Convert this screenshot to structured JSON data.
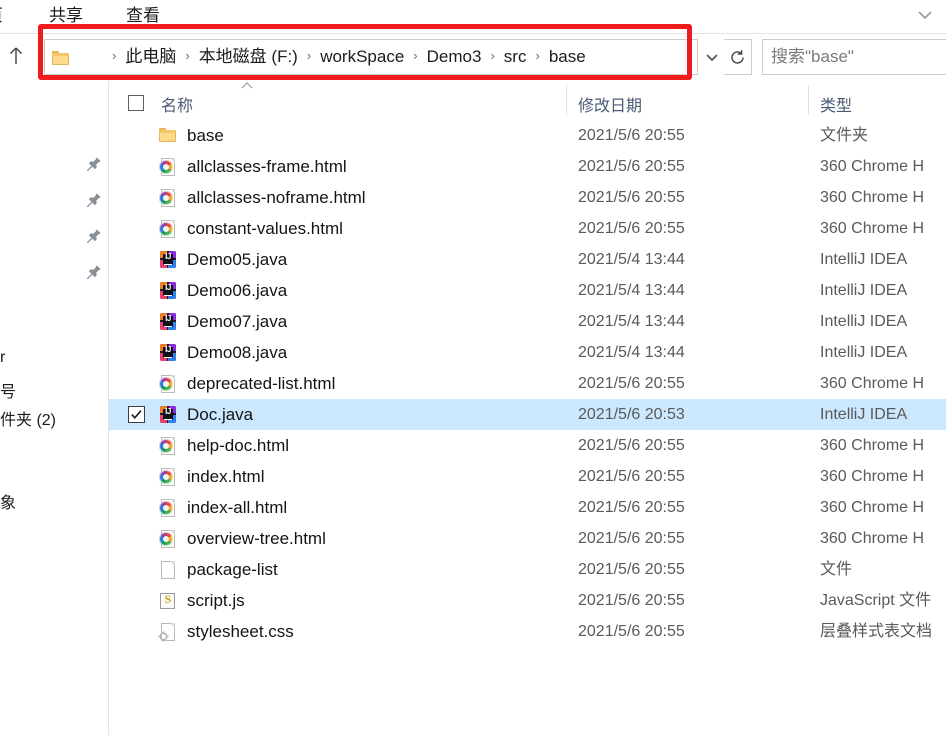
{
  "window": {
    "ribbon_tabs": [
      {
        "label": "页",
        "name": "tab-home"
      },
      {
        "label": "共享",
        "name": "tab-share"
      },
      {
        "label": "查看",
        "name": "tab-view"
      }
    ],
    "ribbon_expand_icon": "chevron-down-icon"
  },
  "navbar": {
    "up_icon": "arrow-up-icon",
    "folder_icon": "folder-icon",
    "breadcrumbs": [
      "此电脑",
      "本地磁盘 (F:)",
      "workSpace",
      "Demo3",
      "src",
      "base"
    ],
    "separator": "›",
    "dropdown_icon": "chevron-down-icon",
    "refresh_icon": "refresh-icon",
    "search": {
      "placeholder": "搜索\"base\"",
      "value": ""
    }
  },
  "annotation": {
    "shape": "rectangle",
    "color": "#ee1c1c"
  },
  "navpane": {
    "pins": [
      "pin-icon",
      "pin-icon",
      "pin-icon",
      "pin-icon"
    ],
    "labels": [
      "r",
      "号",
      "件夹 (2)",
      "象"
    ]
  },
  "columns": {
    "select_all_checkbox": "checkbox",
    "sort_indicator": "caret-up-icon",
    "headers": [
      "名称",
      "修改日期",
      "类型"
    ]
  },
  "files": [
    {
      "name": "base",
      "date": "2021/5/6 20:55",
      "type": "文件夹",
      "icon": "folder-icon",
      "selected": false
    },
    {
      "name": "allclasses-frame.html",
      "date": "2021/5/6 20:55",
      "type": "360 Chrome H",
      "icon": "chrome-html-icon",
      "selected": false
    },
    {
      "name": "allclasses-noframe.html",
      "date": "2021/5/6 20:55",
      "type": "360 Chrome H",
      "icon": "chrome-html-icon",
      "selected": false
    },
    {
      "name": "constant-values.html",
      "date": "2021/5/6 20:55",
      "type": "360 Chrome H",
      "icon": "chrome-html-icon",
      "selected": false
    },
    {
      "name": "Demo05.java",
      "date": "2021/5/4 13:44",
      "type": "IntelliJ IDEA",
      "icon": "intellij-idea-icon",
      "selected": false
    },
    {
      "name": "Demo06.java",
      "date": "2021/5/4 13:44",
      "type": "IntelliJ IDEA",
      "icon": "intellij-idea-icon",
      "selected": false
    },
    {
      "name": "Demo07.java",
      "date": "2021/5/4 13:44",
      "type": "IntelliJ IDEA",
      "icon": "intellij-idea-icon",
      "selected": false
    },
    {
      "name": "Demo08.java",
      "date": "2021/5/4 13:44",
      "type": "IntelliJ IDEA",
      "icon": "intellij-idea-icon",
      "selected": false
    },
    {
      "name": "deprecated-list.html",
      "date": "2021/5/6 20:55",
      "type": "360 Chrome H",
      "icon": "chrome-html-icon",
      "selected": false
    },
    {
      "name": "Doc.java",
      "date": "2021/5/6 20:53",
      "type": "IntelliJ IDEA",
      "icon": "intellij-idea-icon",
      "selected": true
    },
    {
      "name": "help-doc.html",
      "date": "2021/5/6 20:55",
      "type": "360 Chrome H",
      "icon": "chrome-html-icon",
      "selected": false
    },
    {
      "name": "index.html",
      "date": "2021/5/6 20:55",
      "type": "360 Chrome H",
      "icon": "chrome-html-icon",
      "selected": false
    },
    {
      "name": "index-all.html",
      "date": "2021/5/6 20:55",
      "type": "360 Chrome H",
      "icon": "chrome-html-icon",
      "selected": false
    },
    {
      "name": "overview-tree.html",
      "date": "2021/5/6 20:55",
      "type": "360 Chrome H",
      "icon": "chrome-html-icon",
      "selected": false
    },
    {
      "name": "package-list",
      "date": "2021/5/6 20:55",
      "type": "文件",
      "icon": "file-icon",
      "selected": false
    },
    {
      "name": "script.js",
      "date": "2021/5/6 20:55",
      "type": "JavaScript 文件",
      "icon": "javascript-icon",
      "selected": false
    },
    {
      "name": "stylesheet.css",
      "date": "2021/5/6 20:55",
      "type": "层叠样式表文档",
      "icon": "css-icon",
      "selected": false
    }
  ],
  "colors": {
    "selection": "#cce8ff",
    "annotation": "#ee1c1c",
    "header_text": "#4a5b74"
  }
}
